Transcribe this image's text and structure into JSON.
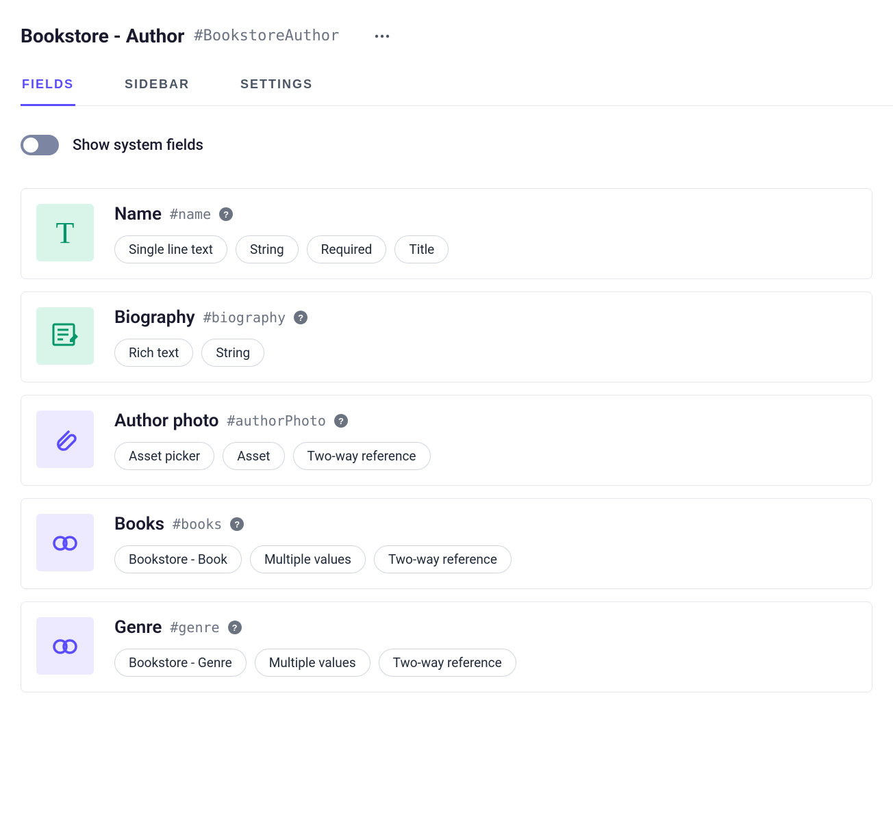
{
  "header": {
    "title": "Bookstore - Author",
    "id": "#BookstoreAuthor"
  },
  "tabs": [
    {
      "label": "FIELDS",
      "active": true
    },
    {
      "label": "SIDEBAR",
      "active": false
    },
    {
      "label": "SETTINGS",
      "active": false
    }
  ],
  "toggle": {
    "label": "Show system fields",
    "on": false
  },
  "fields": [
    {
      "name": "Name",
      "id": "#name",
      "icon": "text",
      "color": "green",
      "pills": [
        "Single line text",
        "String",
        "Required",
        "Title"
      ]
    },
    {
      "name": "Biography",
      "id": "#biography",
      "icon": "richtext",
      "color": "green",
      "pills": [
        "Rich text",
        "String"
      ]
    },
    {
      "name": "Author photo",
      "id": "#authorPhoto",
      "icon": "attachment",
      "color": "purple",
      "pills": [
        "Asset picker",
        "Asset",
        "Two-way reference"
      ]
    },
    {
      "name": "Books",
      "id": "#books",
      "icon": "link",
      "color": "purple",
      "pills": [
        "Bookstore - Book",
        "Multiple values",
        "Two-way reference"
      ]
    },
    {
      "name": "Genre",
      "id": "#genre",
      "icon": "link",
      "color": "purple",
      "pills": [
        "Bookstore - Genre",
        "Multiple values",
        "Two-way reference"
      ]
    }
  ]
}
